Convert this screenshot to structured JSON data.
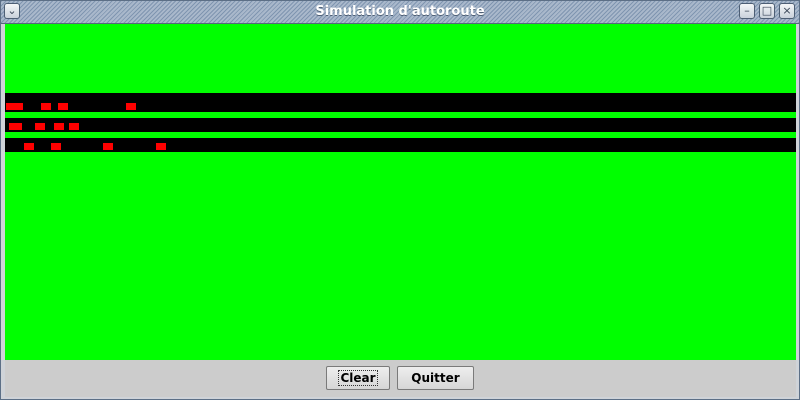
{
  "window": {
    "title": "Simulation d'autoroute",
    "controls": {
      "menu": "⌄",
      "minimize": "–",
      "maximize": "□",
      "close": "×"
    }
  },
  "colors": {
    "background": "#00ff00",
    "road": "#000000",
    "car": "#ff0000"
  },
  "buttons": {
    "clear": "Clear",
    "quit": "Quitter"
  }
}
